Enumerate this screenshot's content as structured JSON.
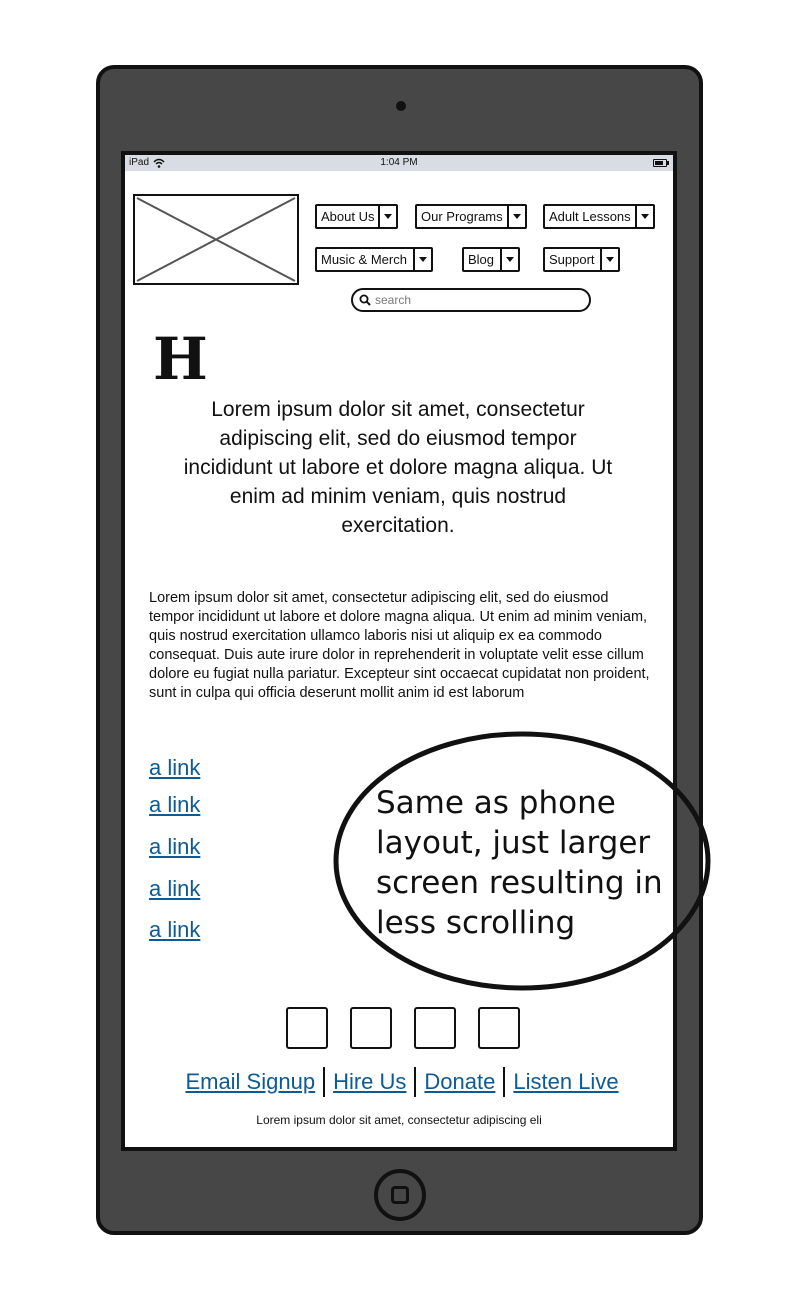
{
  "statusbar": {
    "device": "iPad",
    "time": "1:04 PM"
  },
  "nav": {
    "row1": [
      "About Us",
      "Our Programs",
      "Adult Lessons"
    ],
    "row2": [
      "Music & Merch",
      "Blog",
      "Support"
    ]
  },
  "search": {
    "placeholder": "search"
  },
  "heading": "H",
  "intro": "Lorem ipsum dolor sit amet, consectetur adipiscing elit, sed do eiusmod tempor incididunt ut labore et dolore magna aliqua. Ut enim ad minim veniam, quis nostrud exercitation.",
  "body_text": "Lorem ipsum dolor sit amet, consectetur adipiscing elit, sed do eiusmod tempor incididunt ut labore et dolore magna aliqua. Ut enim ad minim veniam, quis nostrud exercitation ullamco laboris nisi ut aliquip ex ea commodo consequat. Duis aute irure dolor in reprehenderit in voluptate velit esse cillum dolore eu fugiat nulla pariatur. Excepteur sint occaecat cupidatat non proident, sunt in culpa qui officia deserunt mollit anim id est laborum",
  "links": [
    "a link",
    "a link",
    "a link",
    "a link",
    "a link"
  ],
  "footer": {
    "links": [
      "Email Signup",
      "Hire Us",
      "Donate",
      "Listen Live"
    ],
    "text": "Lorem ipsum dolor sit amet, consectetur adipiscing eli"
  },
  "annotation": "Same as phone layout, just larger screen resulting in less scrolling",
  "colors": {
    "device": "#474747",
    "link": "#0d5a96",
    "statusbar": "#d7dde2"
  }
}
